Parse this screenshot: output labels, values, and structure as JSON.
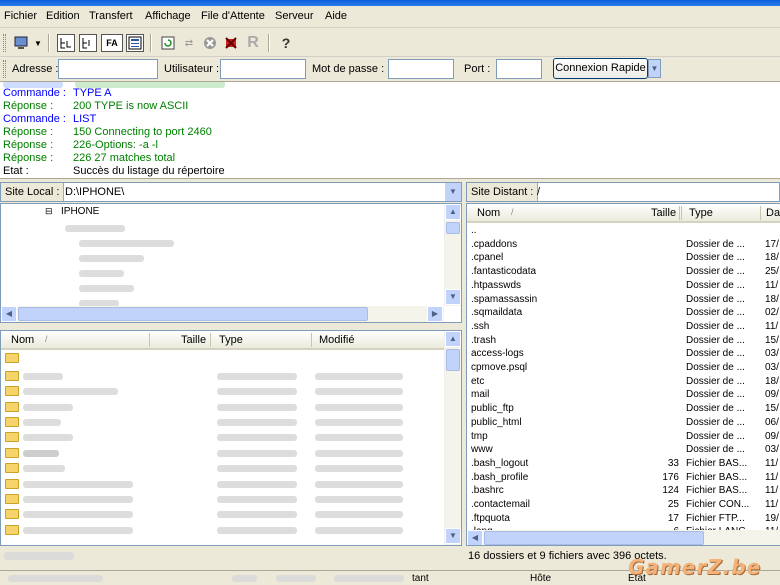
{
  "menu": [
    "Fichier",
    "Edition",
    "Transfert",
    "Affichage",
    "File d'Attente",
    "Serveur",
    "Aide"
  ],
  "toolbar_text": {
    "fa": "FA"
  },
  "quick": {
    "host_label": "Adresse :",
    "user_label": "Utilisateur :",
    "pass_label": "Mot de passe :",
    "port_label": "Port :",
    "connect_label": "Connexion Rapide"
  },
  "log": [
    {
      "k": "Commande :",
      "v": "TYPE A",
      "color": "#0000FF"
    },
    {
      "k": "Réponse :",
      "v": "200 TYPE is now ASCII",
      "color": "#008000"
    },
    {
      "k": "Commande :",
      "v": "LIST",
      "color": "#0000FF"
    },
    {
      "k": "Réponse :",
      "v": "150 Connecting to port 2460",
      "color": "#008000"
    },
    {
      "k": "Réponse :",
      "v": "226-Options: -a -l",
      "color": "#008000"
    },
    {
      "k": "Réponse :",
      "v": "226 27 matches total",
      "color": "#008000"
    },
    {
      "k": "Etat :",
      "v": "Succès du listage du répertoire",
      "color": "#000000"
    }
  ],
  "local": {
    "site_label": "Site Local :",
    "path": "D:\\IPHONE\\",
    "tree_root": "IPHONE",
    "columns": [
      "Nom",
      "Taille",
      "Type",
      "Modifié"
    ]
  },
  "remote": {
    "site_label": "Site Distant :",
    "path": "/",
    "columns": [
      "Nom",
      "Taille",
      "Type",
      "Da"
    ],
    "rows": [
      {
        "name": "..",
        "size": "",
        "type": "",
        "date": ""
      },
      {
        "name": ".cpaddons",
        "size": "",
        "type": "Dossier de ...",
        "date": "17/"
      },
      {
        "name": ".cpanel",
        "size": "",
        "type": "Dossier de ...",
        "date": "18/"
      },
      {
        "name": ".fantasticodata",
        "size": "",
        "type": "Dossier de ...",
        "date": "25/"
      },
      {
        "name": ".htpasswds",
        "size": "",
        "type": "Dossier de ...",
        "date": "11/"
      },
      {
        "name": ".spamassassin",
        "size": "",
        "type": "Dossier de ...",
        "date": "18/"
      },
      {
        "name": ".sqmaildata",
        "size": "",
        "type": "Dossier de ...",
        "date": "02/"
      },
      {
        "name": ".ssh",
        "size": "",
        "type": "Dossier de ...",
        "date": "11/"
      },
      {
        "name": ".trash",
        "size": "",
        "type": "Dossier de ...",
        "date": "15/"
      },
      {
        "name": "access-logs",
        "size": "",
        "type": "Dossier de ...",
        "date": "03/"
      },
      {
        "name": "cpmove.psql",
        "size": "",
        "type": "Dossier de ...",
        "date": "03/"
      },
      {
        "name": "etc",
        "size": "",
        "type": "Dossier de ...",
        "date": "18/"
      },
      {
        "name": "mail",
        "size": "",
        "type": "Dossier de ...",
        "date": "09/"
      },
      {
        "name": "public_ftp",
        "size": "",
        "type": "Dossier de ...",
        "date": "15/"
      },
      {
        "name": "public_html",
        "size": "",
        "type": "Dossier de ...",
        "date": "06/"
      },
      {
        "name": "tmp",
        "size": "",
        "type": "Dossier de ...",
        "date": "09/"
      },
      {
        "name": "www",
        "size": "",
        "type": "Dossier de ...",
        "date": "03/"
      },
      {
        "name": ".bash_logout",
        "size": "33",
        "type": "Fichier BAS...",
        "date": "11/"
      },
      {
        "name": ".bash_profile",
        "size": "176",
        "type": "Fichier BAS...",
        "date": "11/"
      },
      {
        "name": ".bashrc",
        "size": "124",
        "type": "Fichier BAS...",
        "date": "11/"
      },
      {
        "name": ".contactemail",
        "size": "25",
        "type": "Fichier CON...",
        "date": "11/"
      },
      {
        "name": ".ftpquota",
        "size": "17",
        "type": "Fichier FTP...",
        "date": "19/"
      },
      {
        "name": ".lang",
        "size": "6",
        "type": "Fichier LANG",
        "date": "11/"
      }
    ],
    "status": "16 dossiers et 9 fichiers avec 396 octets."
  },
  "queue": {
    "col_host": "Hôte",
    "col_state": "Etat",
    "col_partial": "tant"
  },
  "watermark": "GamerZ.be"
}
